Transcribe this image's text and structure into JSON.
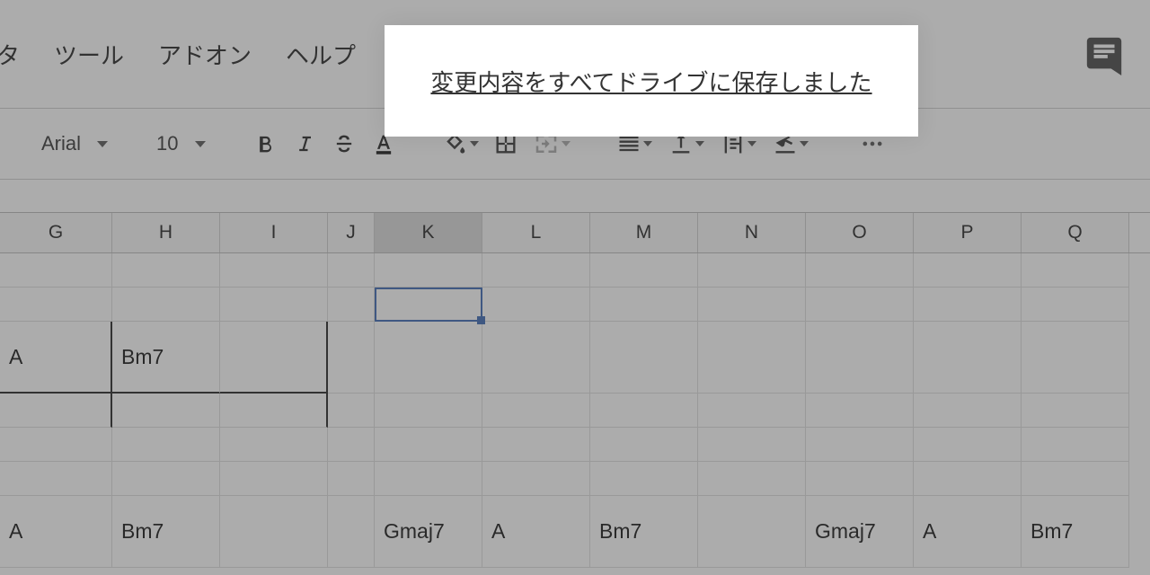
{
  "menu": {
    "items": [
      "ータ",
      "ツール",
      "アドオン",
      "ヘルプ"
    ]
  },
  "save_status": "変更内容をすべてドライブに保存しました",
  "toolbar": {
    "font": "Arial",
    "size": "10"
  },
  "columns": [
    "G",
    "H",
    "I",
    "J",
    "K",
    "L",
    "M",
    "N",
    "O",
    "P",
    "Q"
  ],
  "selected_column_index": 4,
  "selected_cell": {
    "col": "K",
    "row": 2
  },
  "rows": [
    {
      "h": "short",
      "cells": [
        "",
        "",
        "",
        "",
        "",
        "",
        "",
        "",
        "",
        "",
        ""
      ]
    },
    {
      "h": "short",
      "cells": [
        "",
        "",
        "",
        "",
        "",
        "",
        "",
        "",
        "",
        "",
        ""
      ]
    },
    {
      "h": "tall",
      "cells": [
        "A",
        "Bm7",
        "",
        "",
        "",
        "",
        "",
        "",
        "",
        "",
        ""
      ],
      "strong_bottom": [
        0,
        1,
        2
      ],
      "strong_right": [
        0,
        2
      ]
    },
    {
      "h": "short",
      "cells": [
        "",
        "",
        "",
        "",
        "",
        "",
        "",
        "",
        "",
        "",
        ""
      ],
      "strong_right": [
        0,
        2
      ]
    },
    {
      "h": "short",
      "cells": [
        "",
        "",
        "",
        "",
        "",
        "",
        "",
        "",
        "",
        "",
        ""
      ]
    },
    {
      "h": "short",
      "cells": [
        "",
        "",
        "",
        "",
        "",
        "",
        "",
        "",
        "",
        "",
        ""
      ]
    },
    {
      "h": "tall",
      "cells": [
        "A",
        "Bm7",
        "",
        "",
        "Gmaj7",
        "A",
        "Bm7",
        "",
        "Gmaj7",
        "A",
        "Bm7"
      ]
    }
  ],
  "col_classes": [
    "cg",
    "ch",
    "ci",
    "cj",
    "ck",
    "cl",
    "cm",
    "cn",
    "co",
    "cp",
    "cq"
  ]
}
